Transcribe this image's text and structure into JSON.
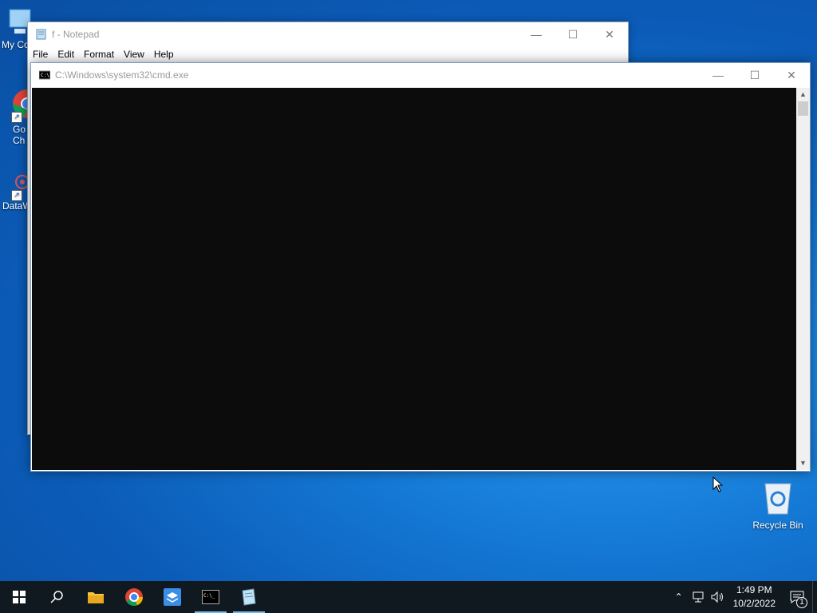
{
  "desktop": {
    "icons": [
      {
        "label": "My Co",
        "kind": "computer"
      },
      {
        "label": "Go\nCh",
        "kind": "chrome-shortcut"
      },
      {
        "label": "DataW",
        "kind": "app-shortcut"
      },
      {
        "label": "Recycle Bin",
        "kind": "recycle-bin"
      }
    ]
  },
  "notepad": {
    "title": "f - Notepad",
    "menu": [
      "File",
      "Edit",
      "Format",
      "View",
      "Help"
    ]
  },
  "cmd": {
    "title": "C:\\Windows\\system32\\cmd.exe"
  },
  "caption": {
    "minimize": "—",
    "maximize": "☐",
    "close": "✕"
  },
  "taskbar": {
    "apps": [
      "start",
      "search",
      "file-explorer",
      "chrome",
      "app-box",
      "cmd",
      "notepad"
    ],
    "clock_time": "1:49 PM",
    "clock_date": "10/2/2022",
    "notification_count": "1"
  }
}
